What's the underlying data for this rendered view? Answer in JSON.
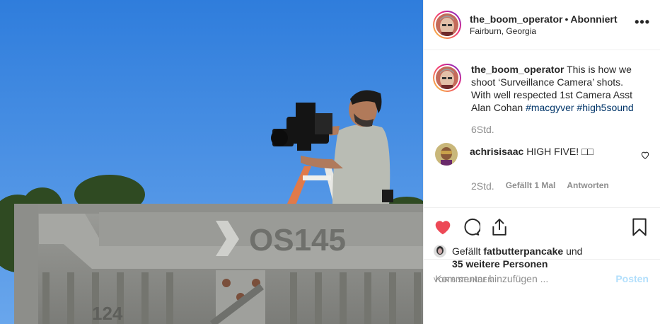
{
  "header": {
    "username": "the_boom_operator",
    "separator": "•",
    "follow_status": "Abonniert",
    "location": "Fairburn, Georgia",
    "more_label": "•••"
  },
  "photo": {
    "container_text": "OS145",
    "container_code": "124"
  },
  "caption": {
    "username": "the_boom_operator",
    "text": "This is how we shoot ‘Surveillance Camera’ shots. With well respected 1st Camera Asst Alan Cohan",
    "hashtag1": "#macgyver",
    "hashtag2": "#high5sound",
    "time": "6Std."
  },
  "comment": {
    "username": "achrisisaac",
    "text": "HIGH FIVE! □□",
    "time": "2Std.",
    "likes": "Gefällt 1 Mal",
    "reply": "Antworten"
  },
  "likes": {
    "prefix": "Gefällt",
    "user": "fatbutterpancake",
    "conjunction": "und",
    "others": "35 weitere Personen"
  },
  "post_time": "VOR 6 STUNDEN",
  "add_comment": {
    "placeholder": "Kommentar hinzufügen ...",
    "post_label": "Posten"
  },
  "colors": {
    "like_red": "#ed4956",
    "link_blue": "#003569",
    "muted": "#8e8e8e",
    "post_disabled": "#b2dffc",
    "sky": "#4d8fe0"
  }
}
